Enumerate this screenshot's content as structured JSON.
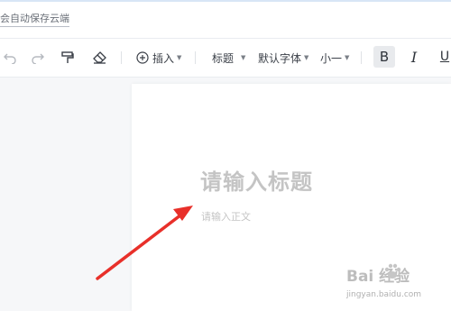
{
  "header": {
    "autosave_text": "会自动保存云端"
  },
  "toolbar": {
    "insert_label": "插入",
    "heading_label": "标题",
    "font_label": "默认字体",
    "size_label": "小一",
    "bold_label": "B",
    "italic_label": "I",
    "underline_label": "U",
    "icons": [
      "undo-icon",
      "redo-icon",
      "format-painter-icon",
      "eraser-icon",
      "plus-circle-icon"
    ]
  },
  "editor": {
    "title_placeholder": "请输入标题",
    "body_placeholder": "请输入正文"
  },
  "watermark": {
    "logo_text": "Bai  经验",
    "sub_text": "jingyan.baidu.com"
  },
  "colors": {
    "annotation_arrow": "#e8302a",
    "placeholder": "#c4c4c4"
  }
}
